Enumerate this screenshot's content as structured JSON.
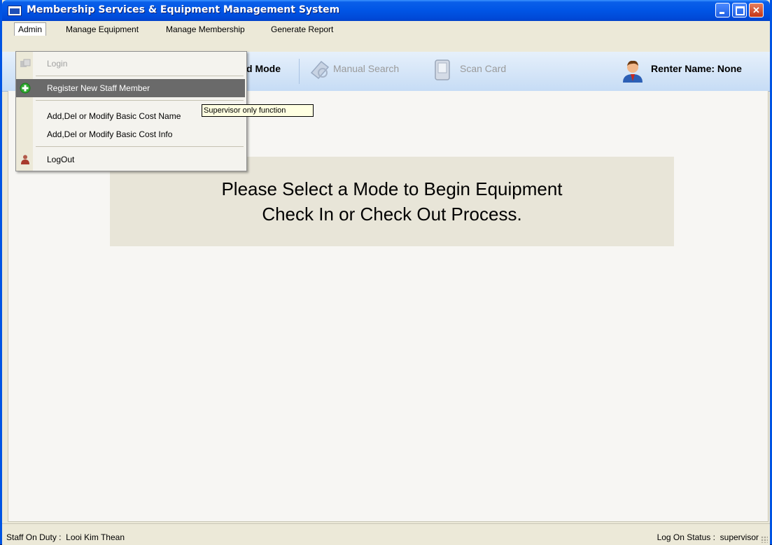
{
  "window": {
    "title": "Membership Services & Equipment Management System"
  },
  "menubar": {
    "items": [
      "Admin",
      "Manage Equipment",
      "Manage Membership",
      "Generate Report"
    ]
  },
  "toolbar": {
    "mode_partial": "d Mode",
    "manual_search": "Manual Search",
    "scan_card": "Scan Card",
    "renter_label": "Renter Name:",
    "renter_value": "None"
  },
  "admin_menu": {
    "login": "Login",
    "register": "Register New Staff Member",
    "cost_name": "Add,Del or Modify Basic Cost Name",
    "cost_info": "Add,Del or Modify Basic Cost Info",
    "logout": "LogOut"
  },
  "tooltip": "Supervisor only function",
  "banner": {
    "line1": "Please Select a Mode to Begin Equipment",
    "line2": "Check In or Check Out Process."
  },
  "status": {
    "staff_label": "Staff On Duty :",
    "staff_value": "Looi Kim Thean",
    "logon_label": "Log On Status :",
    "logon_value": "supervisor"
  },
  "colors": {
    "titlebar": "#0055e5",
    "hover": "#6a6a6a",
    "tooltip_bg": "#ffffe1"
  }
}
